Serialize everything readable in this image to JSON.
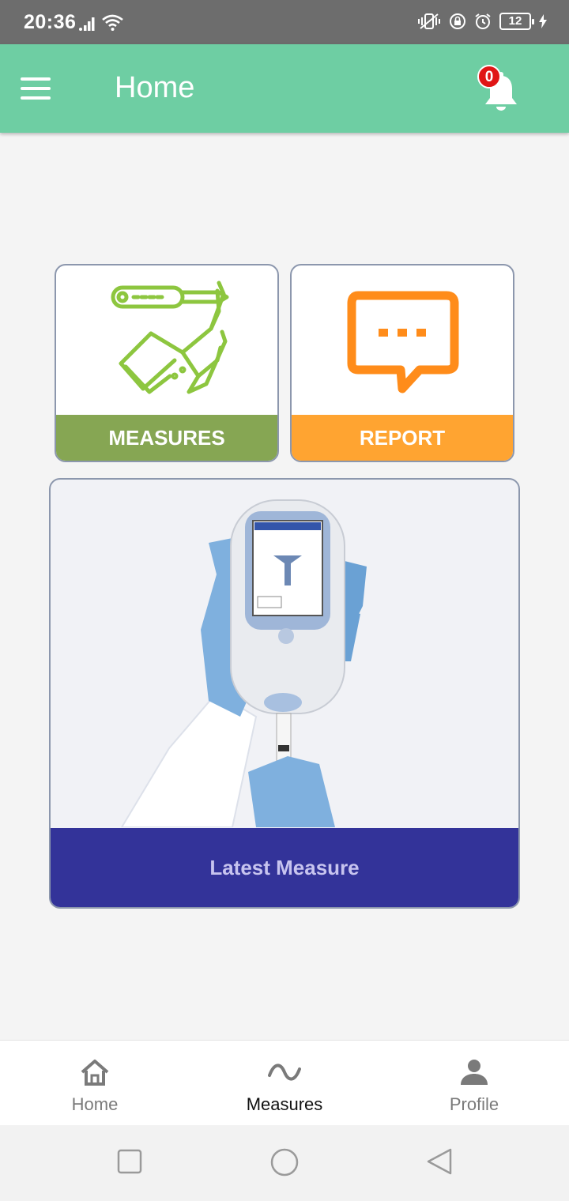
{
  "status_bar": {
    "time": "20:36",
    "battery_level": "12"
  },
  "app_bar": {
    "title": "Home",
    "notification_count": "0"
  },
  "cards": {
    "measures_label": "MEASURES",
    "report_label": "REPORT",
    "latest_label": "Latest Measure"
  },
  "bottom_nav": {
    "items": [
      {
        "label": "Home",
        "icon": "home-icon"
      },
      {
        "label": "Measures",
        "icon": "wave-icon",
        "active": true
      },
      {
        "label": "Profile",
        "icon": "person-icon"
      }
    ]
  },
  "colors": {
    "app_bar": "#6ecea3",
    "measures": "#86a653",
    "report": "#ffa431",
    "latest": "#333399",
    "badge": "#e01515"
  }
}
